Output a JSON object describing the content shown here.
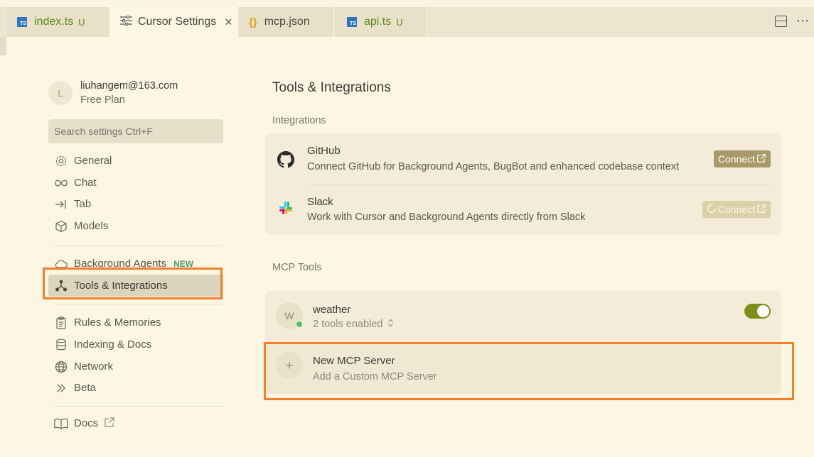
{
  "tabs": [
    {
      "label": "index.ts",
      "badge": "U",
      "icon": "ts-file-icon"
    },
    {
      "label": "Cursor Settings",
      "icon": "settings-sliders-icon",
      "close": "×"
    },
    {
      "label": "mcp.json",
      "icon": "json-file-icon"
    },
    {
      "label": "api.ts",
      "badge": "U",
      "icon": "ts-file-icon"
    }
  ],
  "ts_icon_text": "TS",
  "json_icon_text": "{}",
  "tabbar_more": "⋯",
  "user": {
    "initial": "L",
    "email": "liuhangem@163.com",
    "plan": "Free Plan"
  },
  "search": {
    "placeholder": "Search settings Ctrl+F"
  },
  "nav": {
    "general": "General",
    "chat": "Chat",
    "tab": "Tab",
    "models": "Models",
    "background_agents": "Background Agents",
    "new_badge": "NEW",
    "tools": "Tools & Integrations",
    "rules": "Rules & Memories",
    "indexing": "Indexing & Docs",
    "network": "Network",
    "beta": "Beta",
    "docs": "Docs"
  },
  "main": {
    "title": "Tools & Integrations",
    "integrations_label": "Integrations",
    "github": {
      "name": "GitHub",
      "desc": "Connect GitHub for Background Agents, BugBot and enhanced codebase context",
      "button": "Connect"
    },
    "slack": {
      "name": "Slack",
      "desc": "Work with Cursor and Background Agents directly from Slack",
      "button": "Connect"
    },
    "mcp_label": "MCP Tools",
    "weather": {
      "initial": "W",
      "name": "weather",
      "tools": "2 tools enabled",
      "enabled": true
    },
    "new_server": {
      "icon_text": "+",
      "title": "New MCP Server",
      "desc": "Add a Custom MCP Server"
    }
  },
  "colors": {
    "accent_highlight": "#f5802a",
    "toggle_on": "#7d8f1a",
    "status_online": "#4cc36e"
  }
}
